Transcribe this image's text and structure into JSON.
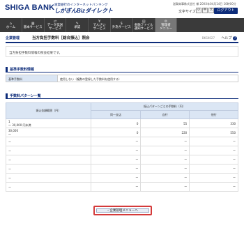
{
  "header": {
    "bank_name": "SHIGA BANK",
    "service_sub": "滋賀銀行のインターネットバンキング",
    "service_name": "しがぎんBizダイレクト",
    "user_info": "滋賀商事株式会社 様 20XX年04月14日 10時00分",
    "font_size_label": "文字サイズ",
    "font_small": "小",
    "font_medium": "中",
    "font_large": "大",
    "logout_label": "ログアウト"
  },
  "nav": [
    {
      "icon": "⌂",
      "label": "ホーム"
    },
    {
      "icon": "▦",
      "label": "基本サービス"
    },
    {
      "icon": "⇄",
      "label": "データ伝送\nサービス"
    },
    {
      "icon": "✎",
      "label": "承認"
    },
    {
      "icon": "¥",
      "label": "でんさい\nサービス"
    },
    {
      "icon": "$",
      "label": "外為サービス"
    },
    {
      "icon": "▤",
      "label": "金融ファイル\n通知サービス"
    },
    {
      "icon": "⚙",
      "label": "管理者\nメニュー"
    }
  ],
  "page": {
    "category": "企業管理",
    "title": "当方負担手数料［総合振込］照会",
    "screen_id": "BKSK027",
    "help_label": "ヘルプ",
    "message": "当方負担手数料情報の照会結果です。"
  },
  "fee_info": {
    "section_title": "基準手数料情報",
    "key": "基準手数料",
    "value": "使用しない（複数の登録した手数料を使用する）"
  },
  "fee_pattern": {
    "section_title": "手数料パターン一覧",
    "col_amount": "振込金額範囲（円）",
    "col_group": "振込パターンごとの手数料（円）",
    "col_same": "同一支店",
    "col_own": "自行",
    "col_other": "他行",
    "rows": [
      {
        "range_line1": "1",
        "range_line2": "〜 30,000 円未満",
        "same": "0",
        "own": "55",
        "other": "330"
      },
      {
        "range_line1": "30,000",
        "range_line2": "〜",
        "same": "0",
        "own": "220",
        "other": "550"
      },
      {
        "range_line1": "ー",
        "range_line2": "",
        "same": "ー",
        "own": "ー",
        "other": "ー"
      },
      {
        "range_line1": "ー",
        "range_line2": "",
        "same": "ー",
        "own": "ー",
        "other": "ー"
      },
      {
        "range_line1": "ー",
        "range_line2": "",
        "same": "ー",
        "own": "ー",
        "other": "ー"
      },
      {
        "range_line1": "ー",
        "range_line2": "",
        "same": "ー",
        "own": "ー",
        "other": "ー"
      },
      {
        "range_line1": "ー",
        "range_line2": "",
        "same": "ー",
        "own": "ー",
        "other": "ー"
      },
      {
        "range_line1": "ー",
        "range_line2": "",
        "same": "ー",
        "own": "ー",
        "other": "ー"
      }
    ]
  },
  "footer": {
    "back_label": "企業管理メニューへ"
  },
  "colors": {
    "brand": "#0d2c7a",
    "nav_bg": "#3a3a3a",
    "highlight": "#d43a3a",
    "header_cell": "#dbe6f4"
  }
}
